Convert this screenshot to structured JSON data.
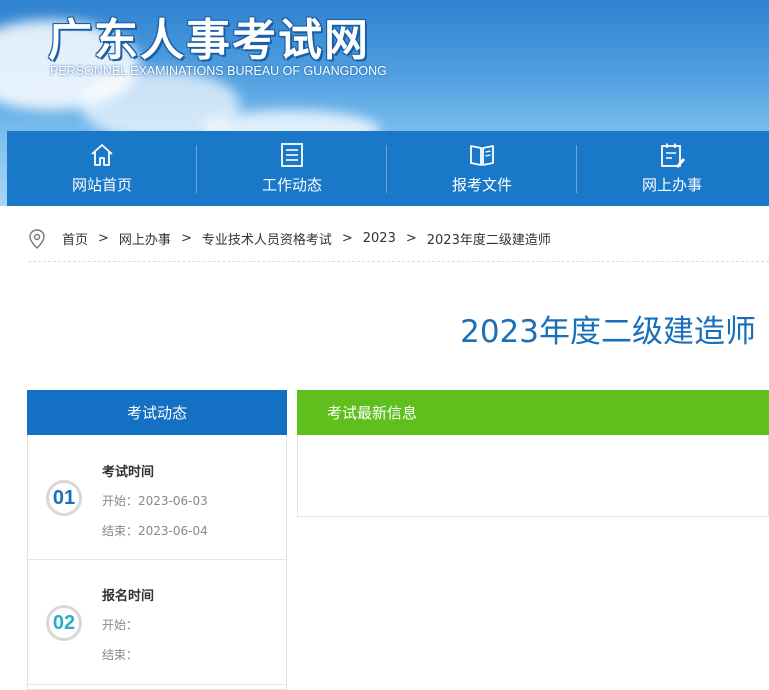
{
  "header": {
    "title": "广东人事考试网",
    "subtitle": "PERSONNEL EXAMINATIONS BUREAU OF GUANGDONG"
  },
  "nav": {
    "items": [
      {
        "label": "网站首页",
        "icon": "home-icon"
      },
      {
        "label": "工作动态",
        "icon": "document-list-icon"
      },
      {
        "label": "报考文件",
        "icon": "open-book-icon"
      },
      {
        "label": "网上办事",
        "icon": "clipboard-pen-icon"
      }
    ]
  },
  "breadcrumb": {
    "icon": "location-pin-icon",
    "items": [
      "首页",
      "网上办事",
      "专业技术人员资格考试",
      "2023",
      "2023年度二级建造师"
    ],
    "separator": ">"
  },
  "page": {
    "title": "2023年度二级建造师"
  },
  "sidebar": {
    "heading": "考试动态",
    "events": [
      {
        "number": "01",
        "title": "考试时间",
        "start": "开始：2023-06-03",
        "end": "结束：2023-06-04",
        "color": "#1b6fba"
      },
      {
        "number": "02",
        "title": "报名时间",
        "start": "开始：",
        "end": "结束：",
        "color": "#23b0c8"
      }
    ]
  },
  "info": {
    "heading": "考试最新信息"
  },
  "colors": {
    "nav_bg": "#1a78c8",
    "sidebar_head": "#1470c2",
    "info_head": "#5fbf1d",
    "title_blue": "#1b6fba"
  }
}
